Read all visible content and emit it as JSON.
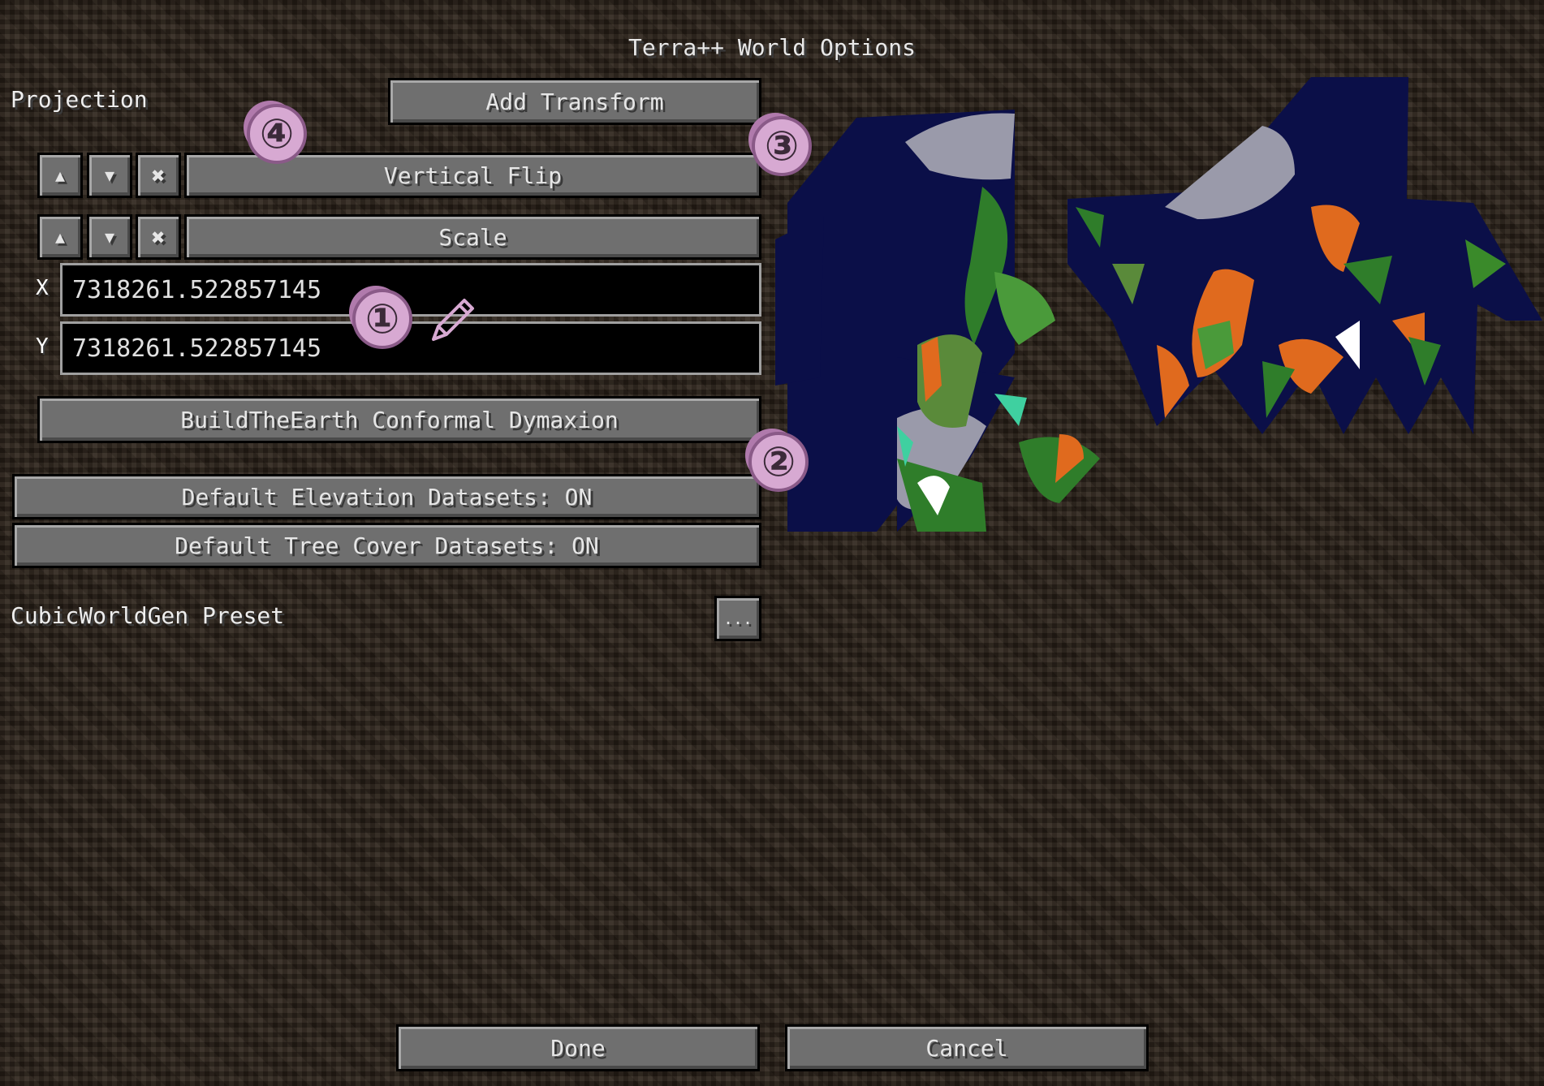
{
  "window": {
    "title": "Terra++ World Options"
  },
  "projection": {
    "label": "Projection",
    "add_transform_label": "Add Transform",
    "transforms": [
      {
        "name": "Vertical Flip",
        "up": "▲",
        "down": "▼",
        "remove": "✖"
      },
      {
        "name": "Scale",
        "up": "▲",
        "down": "▼",
        "remove": "✖"
      }
    ],
    "scale_x_label": "X",
    "scale_x_value": "7318261.522857145",
    "scale_y_label": "Y",
    "scale_y_value": "7318261.522857145",
    "base_projection": "BuildTheEarth Conformal Dymaxion"
  },
  "datasets": {
    "elevation_label": "Default Elevation Datasets: ON",
    "tree_cover_label": "Default Tree Cover Datasets: ON"
  },
  "cwg": {
    "label": "CubicWorldGen Preset",
    "button": "..."
  },
  "footer": {
    "done": "Done",
    "cancel": "Cancel"
  },
  "annotations": [
    "①",
    "②",
    "③",
    "④"
  ],
  "colors": {
    "ocean": "#0b0f48",
    "ice": "#9a9aaa",
    "forest": "#2f7d2a",
    "desert": "#e06a1e",
    "marker": "#d7a9d2"
  }
}
